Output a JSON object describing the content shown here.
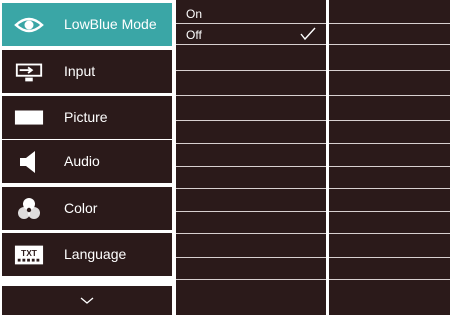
{
  "menu": {
    "items": [
      {
        "label": "LowBlue Mode",
        "icon": "eye-icon",
        "active": true
      },
      {
        "label": "Input",
        "icon": "input-icon",
        "active": false
      },
      {
        "label": "Picture",
        "icon": "picture-icon",
        "active": false
      },
      {
        "label": "Audio",
        "icon": "speaker-icon",
        "active": false
      },
      {
        "label": "Color",
        "icon": "color-circles-icon",
        "active": false
      },
      {
        "label": "Language",
        "icon": "txt-keyboard-icon",
        "active": false
      }
    ],
    "more_icon": "chevron-down-icon"
  },
  "submenu": {
    "options": [
      {
        "label": "On",
        "selected": false
      },
      {
        "label": "Off",
        "selected": true
      }
    ]
  },
  "colors": {
    "panel": "#2b1a1a",
    "active": "#3aa6a6",
    "divider": "#d8d0d0",
    "text": "#ffffff"
  }
}
